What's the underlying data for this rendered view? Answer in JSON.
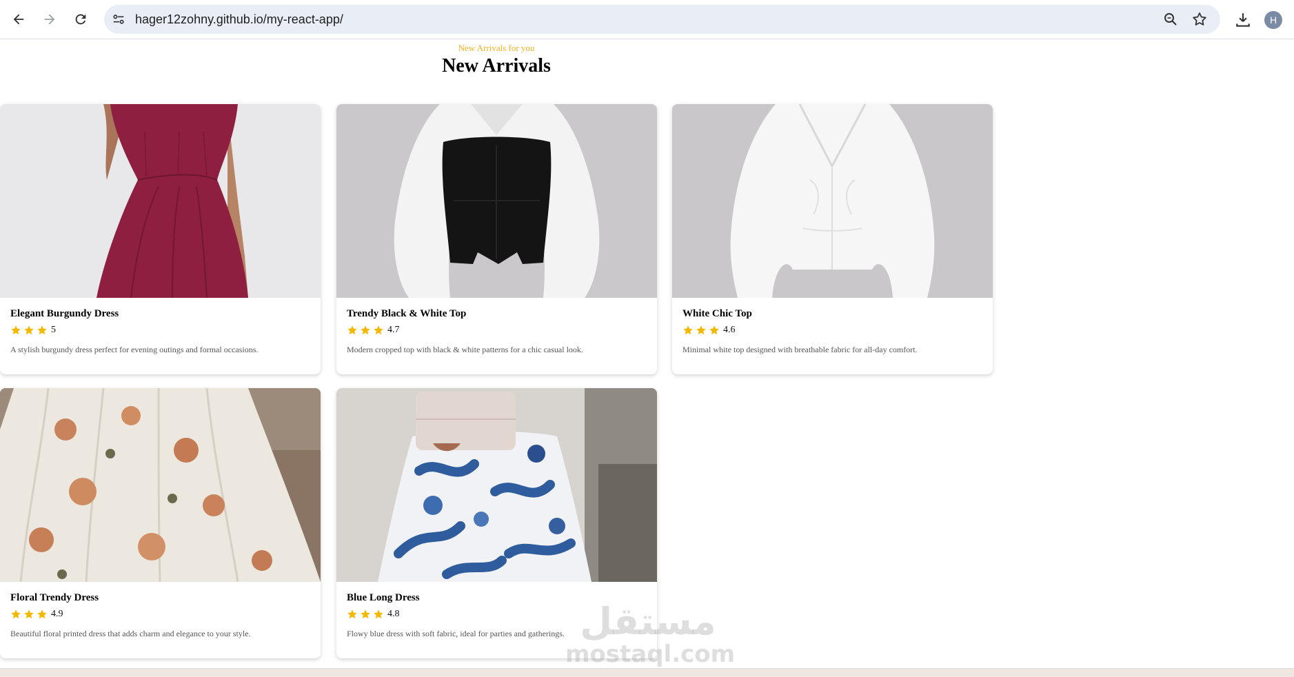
{
  "browser": {
    "url": "hager12zohny.github.io/my-react-app/",
    "avatar_letter": "H"
  },
  "section": {
    "eyebrow": "New Arrivals for you",
    "title": "New Arrivals"
  },
  "products": [
    {
      "name": "Elegant Burgundy Dress",
      "rating": "5",
      "stars": 3,
      "description": "A stylish burgundy dress perfect for evening outings and formal occasions."
    },
    {
      "name": "Trendy Black & White Top",
      "rating": "4.7",
      "stars": 3,
      "description": "Modern cropped top with black & white patterns for a chic casual look."
    },
    {
      "name": "White Chic Top",
      "rating": "4.6",
      "stars": 3,
      "description": "Minimal white top designed with breathable fabric for all-day comfort."
    },
    {
      "name": "Floral Trendy Dress",
      "rating": "4.9",
      "stars": 3,
      "description": "Beautiful floral printed dress that adds charm and elegance to your style."
    },
    {
      "name": "Blue Long Dress",
      "rating": "4.8",
      "stars": 3,
      "description": "Flowy blue dress with soft fabric, ideal for parties and gatherings."
    }
  ],
  "watermark": {
    "arabic": "مستقل",
    "latin": "mostaql.com"
  },
  "colors": {
    "accent": "#f2b01e",
    "star": "#f5b800"
  }
}
